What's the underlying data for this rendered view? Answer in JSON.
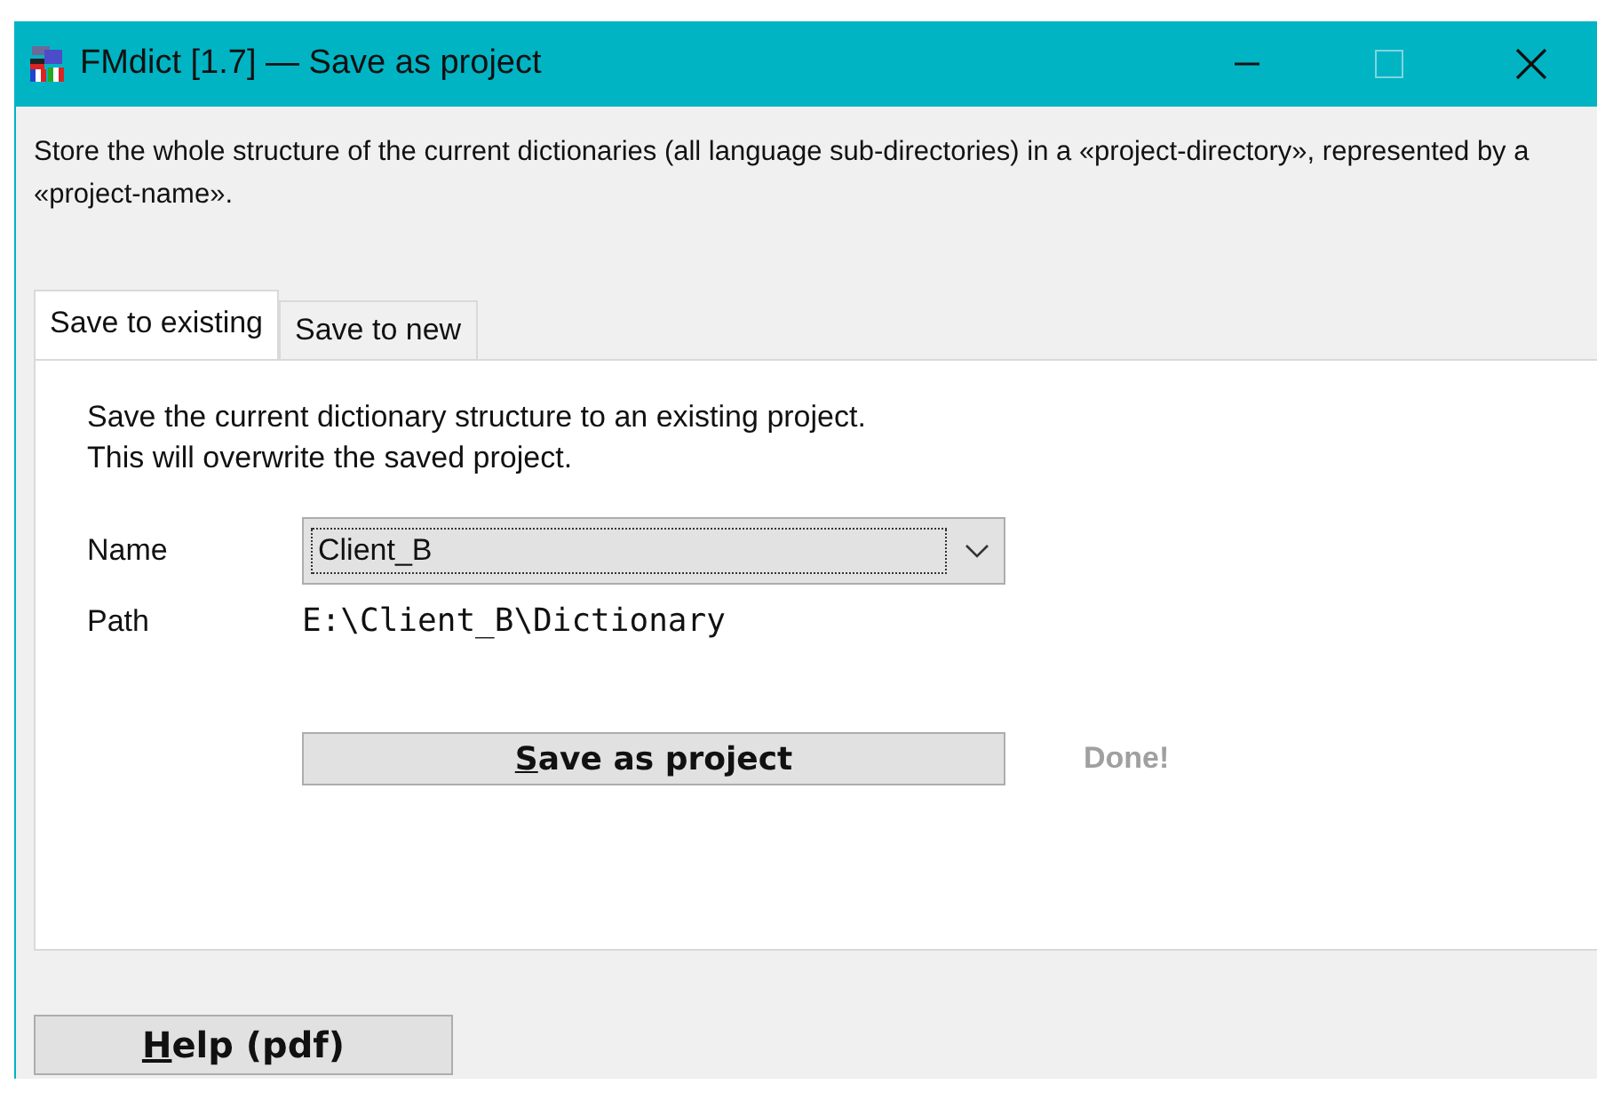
{
  "window": {
    "title": "FMdict [1.7] — Save as project",
    "maximize_disabled": true
  },
  "description": "Store the whole structure of the current dictionaries (all language sub-directories) in a «project-directory», represented by a «project-name».",
  "tabs": [
    {
      "label": "Save to existing",
      "selected": true
    },
    {
      "label": "Save to new",
      "selected": false
    }
  ],
  "panel": {
    "intro": [
      "Save the current dictionary structure to an existing project.",
      "This will overwrite the saved project."
    ],
    "name_label": "Name",
    "name_value": "Client_B",
    "path_label": "Path",
    "path_value": "E:\\Client_B\\Dictionary",
    "save_button": {
      "label": "Save as project",
      "mnemonic_first": true
    },
    "status": {
      "text": "Done!",
      "disabled": true
    }
  },
  "help_button": {
    "label": "Help (pdf)",
    "mnemonic_first": true
  }
}
